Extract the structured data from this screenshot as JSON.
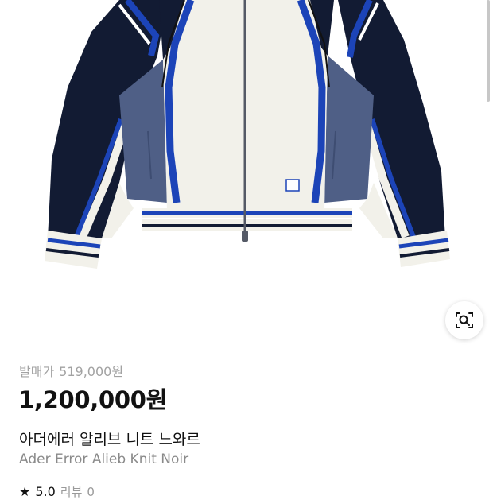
{
  "product": {
    "image_alt": "Ader Error Alieb Knit Noir",
    "release_label": "발매가",
    "release_price": "519,000원",
    "price": "1,200,000원",
    "name_ko": "아더에러 알리브 니트 느와르",
    "name_en": "Ader Error Alieb Knit Noir",
    "rating": "5.0",
    "review_label": "리뷰",
    "review_count": "0"
  },
  "icons": {
    "lens": "image-search-icon",
    "star": "star-icon"
  },
  "colors": {
    "navy": "#121b33",
    "cream": "#f2f1ea",
    "blue": "#1c44b8",
    "slate": "#4f5f86"
  }
}
